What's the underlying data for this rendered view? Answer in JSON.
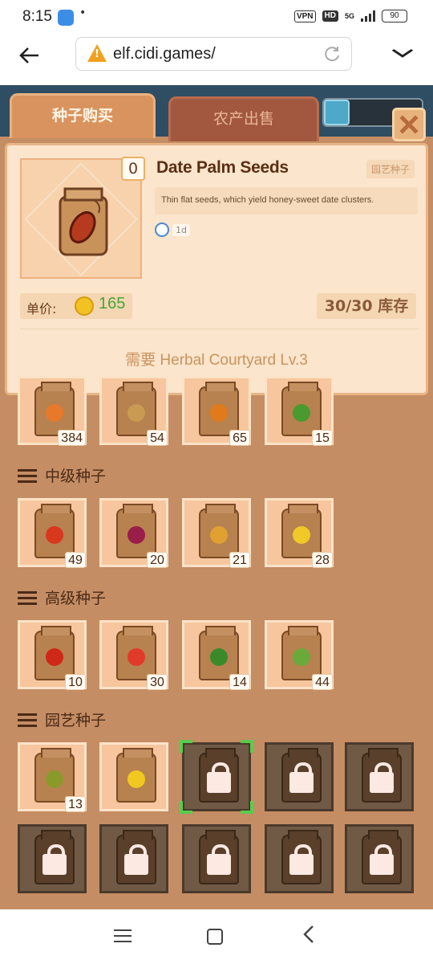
{
  "status_bar": {
    "time": "8:15",
    "vpn": "VPN",
    "hd": "HD",
    "net": "5G",
    "battery": "90"
  },
  "browser": {
    "url": "elf.cidi.games/",
    "back_icon": "arrow-left-icon",
    "warning_icon": "warning-triangle-icon",
    "reload_icon": "reload-icon",
    "menu_icon": "chevron-down-icon"
  },
  "tabs": {
    "buy": "种子购买",
    "sell": "农产出售"
  },
  "detail": {
    "name": "Date Palm Seeds",
    "quantity": "0",
    "category": "园艺种子",
    "description": "Thin flat seeds, which yield honey-sweet date clusters.",
    "grow_time": "1d",
    "price_label": "单价:",
    "price": "165",
    "stock": "30/30 库存",
    "requirement": "需要 Herbal Courtyard Lv.3"
  },
  "basic_row": {
    "items": [
      {
        "name": "carrot",
        "count": "384",
        "color": "#e8782a"
      },
      {
        "name": "potato",
        "count": "54",
        "color": "#c99a52"
      },
      {
        "name": "pumpkin",
        "count": "65",
        "color": "#e07a1a"
      },
      {
        "name": "broccoli",
        "count": "15",
        "color": "#4a9a30"
      }
    ]
  },
  "sections": [
    {
      "title": "中级种子",
      "items": [
        {
          "name": "tomato",
          "count": "49",
          "color": "#d8381e"
        },
        {
          "name": "beet",
          "count": "20",
          "color": "#9a1e4a"
        },
        {
          "name": "wheat",
          "count": "21",
          "color": "#e0a032"
        },
        {
          "name": "corn",
          "count": "28",
          "color": "#f0c828"
        }
      ]
    },
    {
      "title": "高级种子",
      "items": [
        {
          "name": "chili",
          "count": "10",
          "color": "#d02818"
        },
        {
          "name": "strawberry",
          "count": "30",
          "color": "#e03a2a"
        },
        {
          "name": "watermelon",
          "count": "14",
          "color": "#3a8a2a"
        },
        {
          "name": "aloe",
          "count": "44",
          "color": "#6aaa3a"
        }
      ]
    },
    {
      "title": "园艺种子",
      "items": [
        {
          "name": "kiwi",
          "count": "13",
          "color": "#8a9a2a"
        },
        {
          "name": "banana",
          "count": "",
          "color": "#f0c820"
        }
      ]
    }
  ],
  "colors": {
    "game_bg": "#c58d64",
    "panel_bg": "#fbe5cc",
    "price_green": "#4aa337",
    "selection_green": "#5acb4f"
  }
}
